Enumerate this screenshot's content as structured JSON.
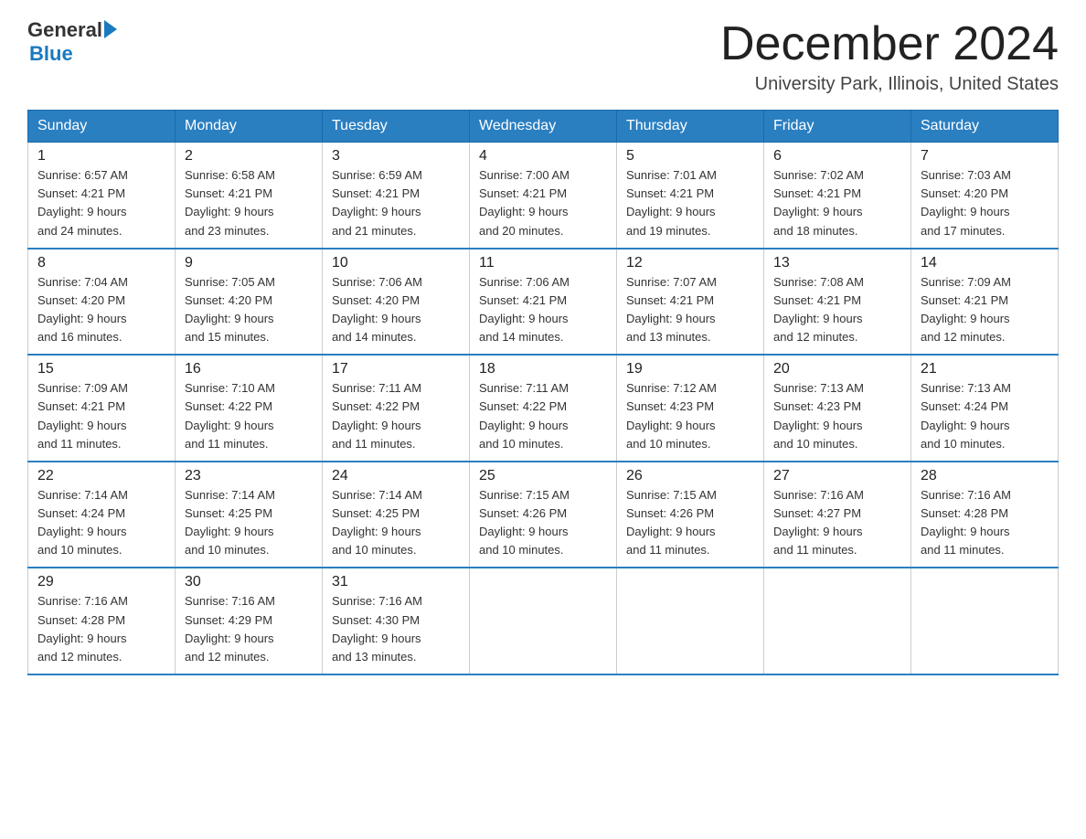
{
  "header": {
    "logo_general": "General",
    "logo_blue": "Blue",
    "month_title": "December 2024",
    "location": "University Park, Illinois, United States"
  },
  "days_of_week": [
    "Sunday",
    "Monday",
    "Tuesday",
    "Wednesday",
    "Thursday",
    "Friday",
    "Saturday"
  ],
  "weeks": [
    [
      {
        "num": "1",
        "sunrise": "6:57 AM",
        "sunset": "4:21 PM",
        "daylight": "9 hours and 24 minutes."
      },
      {
        "num": "2",
        "sunrise": "6:58 AM",
        "sunset": "4:21 PM",
        "daylight": "9 hours and 23 minutes."
      },
      {
        "num": "3",
        "sunrise": "6:59 AM",
        "sunset": "4:21 PM",
        "daylight": "9 hours and 21 minutes."
      },
      {
        "num": "4",
        "sunrise": "7:00 AM",
        "sunset": "4:21 PM",
        "daylight": "9 hours and 20 minutes."
      },
      {
        "num": "5",
        "sunrise": "7:01 AM",
        "sunset": "4:21 PM",
        "daylight": "9 hours and 19 minutes."
      },
      {
        "num": "6",
        "sunrise": "7:02 AM",
        "sunset": "4:21 PM",
        "daylight": "9 hours and 18 minutes."
      },
      {
        "num": "7",
        "sunrise": "7:03 AM",
        "sunset": "4:20 PM",
        "daylight": "9 hours and 17 minutes."
      }
    ],
    [
      {
        "num": "8",
        "sunrise": "7:04 AM",
        "sunset": "4:20 PM",
        "daylight": "9 hours and 16 minutes."
      },
      {
        "num": "9",
        "sunrise": "7:05 AM",
        "sunset": "4:20 PM",
        "daylight": "9 hours and 15 minutes."
      },
      {
        "num": "10",
        "sunrise": "7:06 AM",
        "sunset": "4:20 PM",
        "daylight": "9 hours and 14 minutes."
      },
      {
        "num": "11",
        "sunrise": "7:06 AM",
        "sunset": "4:21 PM",
        "daylight": "9 hours and 14 minutes."
      },
      {
        "num": "12",
        "sunrise": "7:07 AM",
        "sunset": "4:21 PM",
        "daylight": "9 hours and 13 minutes."
      },
      {
        "num": "13",
        "sunrise": "7:08 AM",
        "sunset": "4:21 PM",
        "daylight": "9 hours and 12 minutes."
      },
      {
        "num": "14",
        "sunrise": "7:09 AM",
        "sunset": "4:21 PM",
        "daylight": "9 hours and 12 minutes."
      }
    ],
    [
      {
        "num": "15",
        "sunrise": "7:09 AM",
        "sunset": "4:21 PM",
        "daylight": "9 hours and 11 minutes."
      },
      {
        "num": "16",
        "sunrise": "7:10 AM",
        "sunset": "4:22 PM",
        "daylight": "9 hours and 11 minutes."
      },
      {
        "num": "17",
        "sunrise": "7:11 AM",
        "sunset": "4:22 PM",
        "daylight": "9 hours and 11 minutes."
      },
      {
        "num": "18",
        "sunrise": "7:11 AM",
        "sunset": "4:22 PM",
        "daylight": "9 hours and 10 minutes."
      },
      {
        "num": "19",
        "sunrise": "7:12 AM",
        "sunset": "4:23 PM",
        "daylight": "9 hours and 10 minutes."
      },
      {
        "num": "20",
        "sunrise": "7:13 AM",
        "sunset": "4:23 PM",
        "daylight": "9 hours and 10 minutes."
      },
      {
        "num": "21",
        "sunrise": "7:13 AM",
        "sunset": "4:24 PM",
        "daylight": "9 hours and 10 minutes."
      }
    ],
    [
      {
        "num": "22",
        "sunrise": "7:14 AM",
        "sunset": "4:24 PM",
        "daylight": "9 hours and 10 minutes."
      },
      {
        "num": "23",
        "sunrise": "7:14 AM",
        "sunset": "4:25 PM",
        "daylight": "9 hours and 10 minutes."
      },
      {
        "num": "24",
        "sunrise": "7:14 AM",
        "sunset": "4:25 PM",
        "daylight": "9 hours and 10 minutes."
      },
      {
        "num": "25",
        "sunrise": "7:15 AM",
        "sunset": "4:26 PM",
        "daylight": "9 hours and 10 minutes."
      },
      {
        "num": "26",
        "sunrise": "7:15 AM",
        "sunset": "4:26 PM",
        "daylight": "9 hours and 11 minutes."
      },
      {
        "num": "27",
        "sunrise": "7:16 AM",
        "sunset": "4:27 PM",
        "daylight": "9 hours and 11 minutes."
      },
      {
        "num": "28",
        "sunrise": "7:16 AM",
        "sunset": "4:28 PM",
        "daylight": "9 hours and 11 minutes."
      }
    ],
    [
      {
        "num": "29",
        "sunrise": "7:16 AM",
        "sunset": "4:28 PM",
        "daylight": "9 hours and 12 minutes."
      },
      {
        "num": "30",
        "sunrise": "7:16 AM",
        "sunset": "4:29 PM",
        "daylight": "9 hours and 12 minutes."
      },
      {
        "num": "31",
        "sunrise": "7:16 AM",
        "sunset": "4:30 PM",
        "daylight": "9 hours and 13 minutes."
      },
      null,
      null,
      null,
      null
    ]
  ],
  "labels": {
    "sunrise": "Sunrise:",
    "sunset": "Sunset:",
    "daylight": "Daylight:"
  }
}
